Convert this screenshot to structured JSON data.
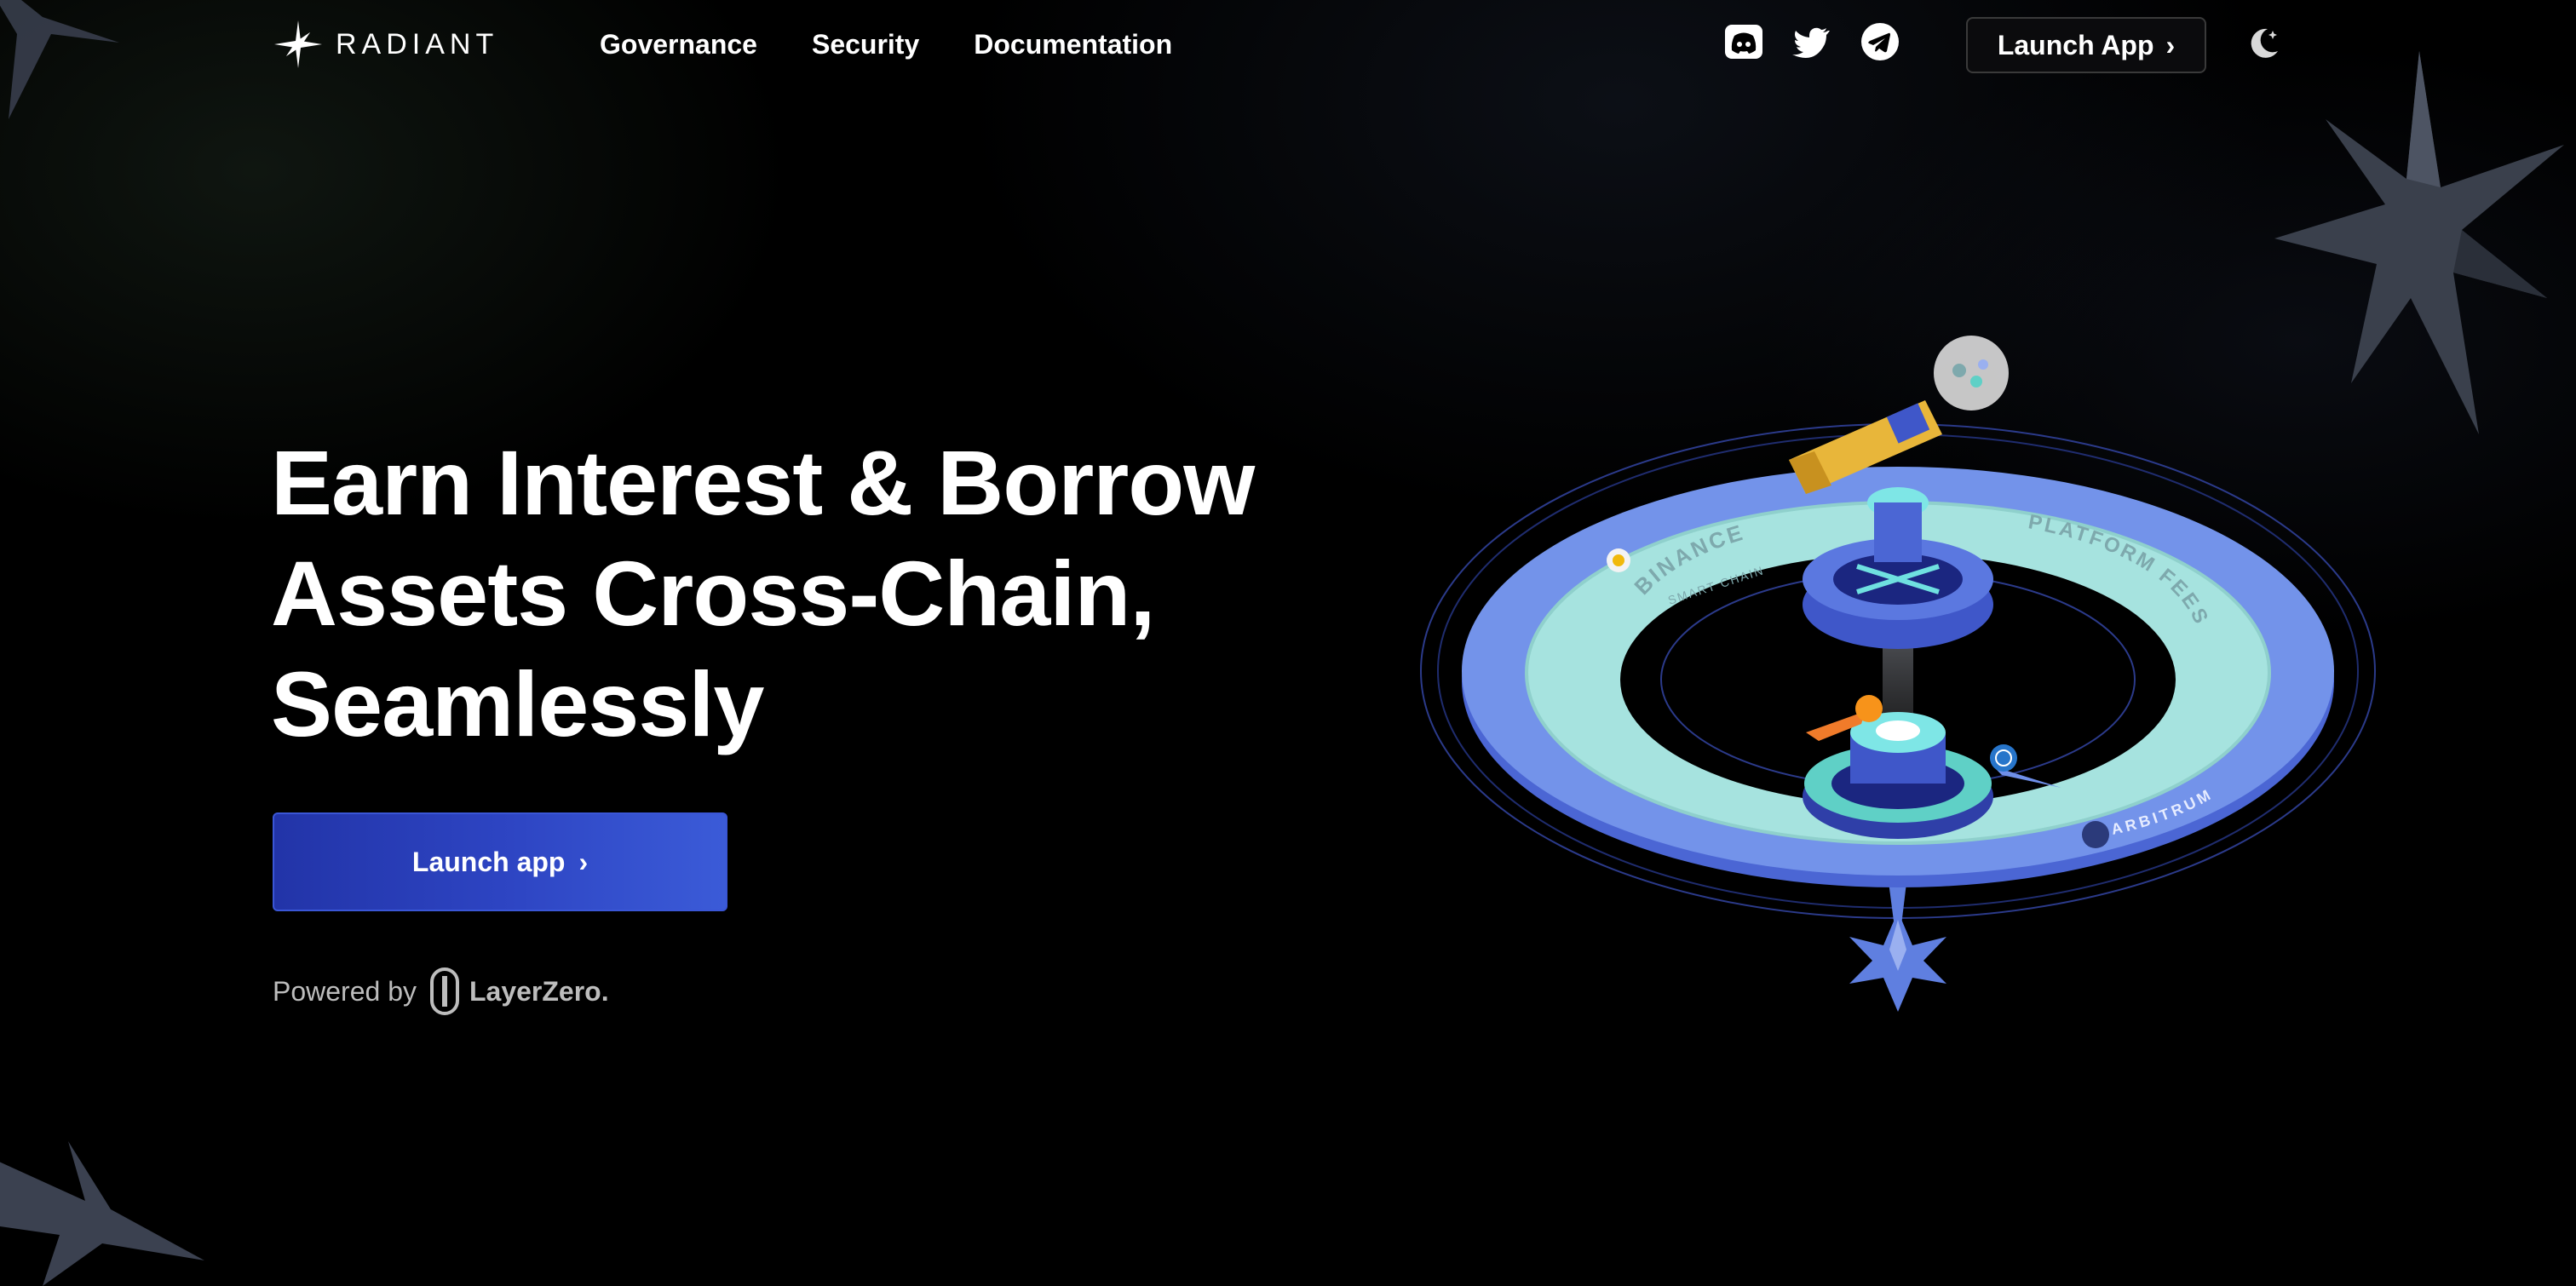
{
  "brand": {
    "name": "RADIANT",
    "logo_icon": "radiant-star-icon"
  },
  "nav": {
    "items": [
      {
        "label": "Governance"
      },
      {
        "label": "Security"
      },
      {
        "label": "Documentation"
      }
    ]
  },
  "socials": {
    "discord_icon": "discord-icon",
    "twitter_icon": "twitter-icon",
    "telegram_icon": "telegram-icon"
  },
  "header_cta": {
    "label": "Launch App",
    "chevron": "›"
  },
  "theme_toggle": {
    "icon": "moon-star-icon"
  },
  "hero": {
    "title_lines": [
      "Earn Interest & Borrow",
      "Assets Cross-Chain,",
      "Seamlessly"
    ],
    "cta_label": "Launch app",
    "cta_chevron": "›"
  },
  "powered_by": {
    "label": "Powered by",
    "partner": "LayerZero."
  },
  "illustration": {
    "ring_label_left": "BINANCE",
    "ring_label_left_sub": "SMART CHAIN",
    "ring_label_right": "PLATFORM FEES",
    "ring_label_bottom": "ARBITRUM"
  },
  "colors": {
    "background": "#000000",
    "accent": "#3150cf",
    "ring_blue": "#6f8fe8",
    "ring_mint": "#a6e3df",
    "muted_text": "#bdbdbd"
  }
}
